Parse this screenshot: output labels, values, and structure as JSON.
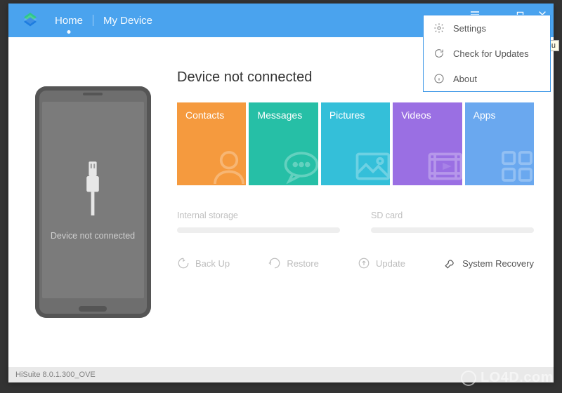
{
  "header": {
    "tabs": {
      "home": "Home",
      "mydevice": "My Device"
    }
  },
  "dropdown": {
    "settings": "Settings",
    "check_updates": "Check for Updates",
    "about": "About"
  },
  "tooltip_fragment": "enu",
  "phone": {
    "status": "Device not connected"
  },
  "main": {
    "status_title": "Device not connected",
    "usb_button": "USB",
    "tiles": {
      "contacts": {
        "label": "Contacts",
        "color": "#f59a3e"
      },
      "messages": {
        "label": "Messages",
        "color": "#26bfa6"
      },
      "pictures": {
        "label": "Pictures",
        "color": "#34bfd9"
      },
      "videos": {
        "label": "Videos",
        "color": "#9a6fe3"
      },
      "apps": {
        "label": "Apps",
        "color": "#6aa8ef"
      }
    },
    "storage": {
      "internal_label": "Internal storage",
      "sd_label": "SD card"
    },
    "actions": {
      "backup": "Back Up",
      "restore": "Restore",
      "update": "Update",
      "recovery": "System Recovery"
    }
  },
  "statusbar": {
    "version": "HiSuite 8.0.1.300_OVE"
  },
  "watermark": "LO4D.com"
}
